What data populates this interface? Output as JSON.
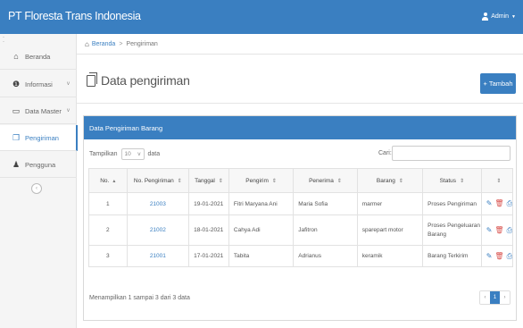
{
  "app": {
    "title": "PT Floresta Trans Indonesia",
    "user_menu": "Admin"
  },
  "sidebar": {
    "items": [
      {
        "label": "Beranda",
        "icon": "home-icon"
      },
      {
        "label": "Informasi",
        "icon": "info-icon"
      },
      {
        "label": "Data Master",
        "icon": "folder-icon"
      },
      {
        "label": "Pengiriman",
        "icon": "document-icon",
        "active": true
      },
      {
        "label": "Pengguna",
        "icon": "user-icon"
      }
    ]
  },
  "breadcrumb": {
    "home": "Beranda",
    "current": "Pengiriman"
  },
  "page": {
    "title": "Data pengiriman",
    "add_button": "Tambah"
  },
  "panel": {
    "title": "Data Pengiriman Barang",
    "show_label": "Tampilkan",
    "show_value": "10",
    "show_suffix": "data",
    "search_label": "Cari:",
    "search_value": ""
  },
  "table": {
    "columns": [
      "No.",
      "No. Pengiriman",
      "Tanggal",
      "Pengirim",
      "Penerima",
      "Barang",
      "Status",
      ""
    ],
    "rows": [
      {
        "no": "1",
        "no_pengiriman": "21003",
        "tanggal": "19-01-2021",
        "pengirim": "Fitri Maryana Ani",
        "penerima": "Maria Sofia",
        "barang": "marmer",
        "status": "Proses Pengiriman"
      },
      {
        "no": "2",
        "no_pengiriman": "21002",
        "tanggal": "18-01-2021",
        "pengirim": "Cahya Adi",
        "penerima": "Jafitron",
        "barang": "sparepart motor",
        "status": "Proses Pengeluaran Barang"
      },
      {
        "no": "3",
        "no_pengiriman": "21001",
        "tanggal": "17-01-2021",
        "pengirim": "Tabita",
        "penerima": "Adrianus",
        "barang": "keramik",
        "status": "Barang Terkirim"
      }
    ]
  },
  "footer": {
    "info": "Menampilkan 1 sampai 3 dari 3 data",
    "current_page": "1"
  },
  "colors": {
    "primary": "#3a7fc1",
    "danger": "#d9534f"
  }
}
